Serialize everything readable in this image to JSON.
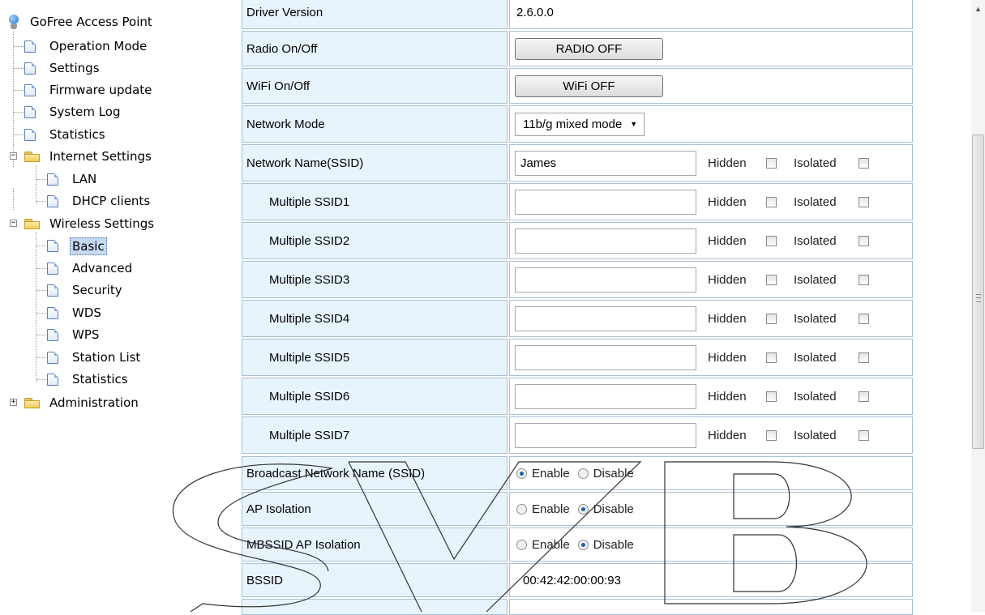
{
  "tree": {
    "root": "GoFree Access Point",
    "items": {
      "operation_mode": "Operation Mode",
      "settings": "Settings",
      "firmware_update": "Firmware update",
      "system_log": "System Log",
      "statistics": "Statistics",
      "internet_settings": "Internet Settings",
      "lan": "LAN",
      "dhcp_clients": "DHCP clients",
      "wireless_settings": "Wireless Settings",
      "basic": "Basic",
      "advanced": "Advanced",
      "security": "Security",
      "wds": "WDS",
      "wps": "WPS",
      "station_list": "Station List",
      "wireless_statistics": "Statistics",
      "administration": "Administration"
    }
  },
  "form": {
    "driver_version": {
      "label": "Driver Version",
      "value": "2.6.0.0"
    },
    "radio": {
      "label": "Radio On/Off",
      "button": "RADIO OFF"
    },
    "wifi": {
      "label": "WiFi On/Off",
      "button": "WiFi OFF"
    },
    "network_mode": {
      "label": "Network Mode",
      "value": "11b/g mixed mode"
    },
    "ssid_main": {
      "label": "Network Name(SSID)",
      "value": "James"
    },
    "multi_ssid": [
      {
        "label": "Multiple SSID1",
        "value": ""
      },
      {
        "label": "Multiple SSID2",
        "value": ""
      },
      {
        "label": "Multiple SSID3",
        "value": ""
      },
      {
        "label": "Multiple SSID4",
        "value": ""
      },
      {
        "label": "Multiple SSID5",
        "value": ""
      },
      {
        "label": "Multiple SSID6",
        "value": ""
      },
      {
        "label": "Multiple SSID7",
        "value": ""
      }
    ],
    "hidden_label": "Hidden",
    "isolated_label": "Isolated",
    "broadcast": {
      "label": "Broadcast Network Name (SSID)",
      "selected": "Enable"
    },
    "ap_isolation": {
      "label": "AP Isolation",
      "selected": "Disable"
    },
    "mbssid_isolation": {
      "label": "MBSSID AP Isolation",
      "selected": "Disable"
    },
    "enable_label": "Enable",
    "disable_label": "Disable",
    "bssid": {
      "label": "BSSID",
      "value": "00:42:42:00:00:93"
    }
  },
  "colors": {
    "label_cell_bg": "#e8f4fc",
    "cell_border": "#a9bfd6",
    "selected_bg": "#c5d9f1"
  }
}
